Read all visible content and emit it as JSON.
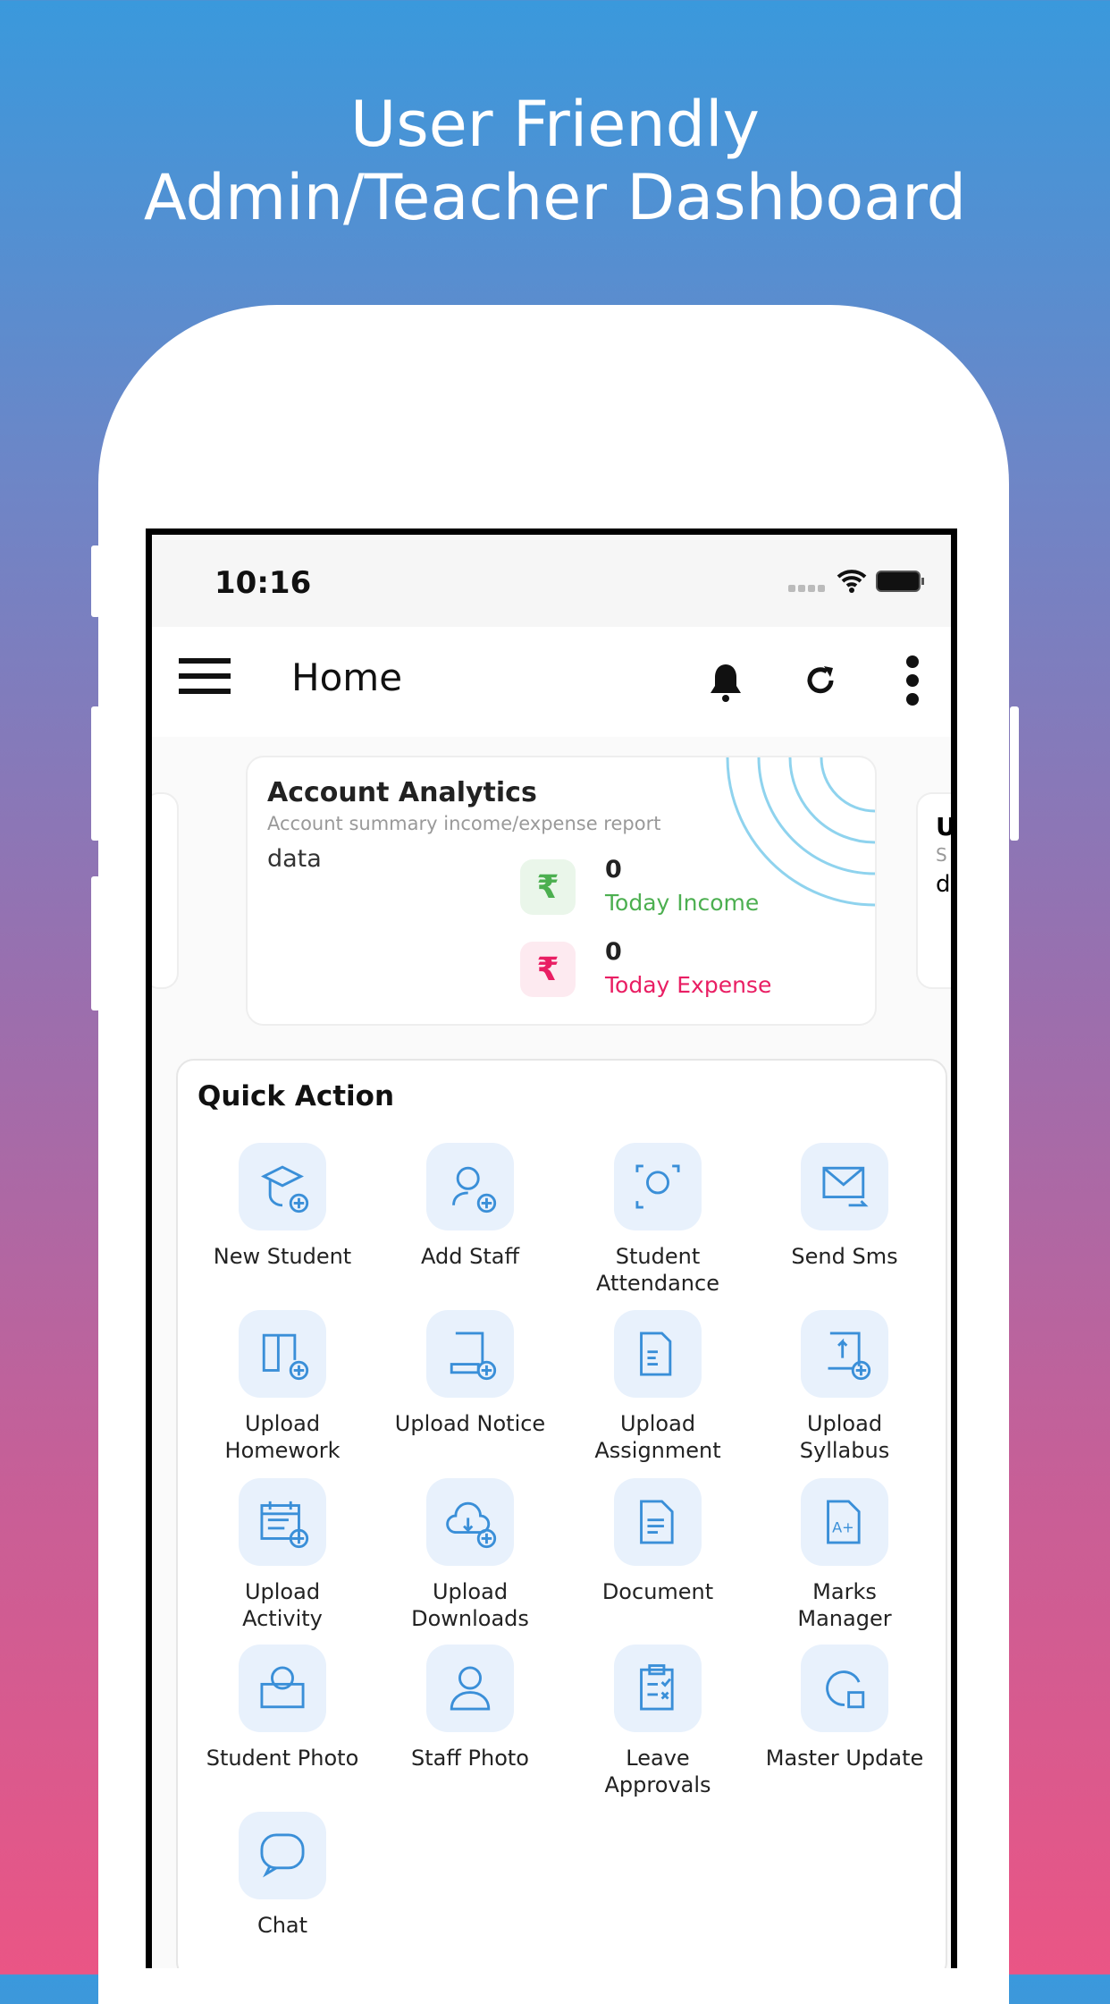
{
  "headline": {
    "line1": "User Friendly",
    "line2": "Admin/Teacher Dashboard"
  },
  "status_bar": {
    "time": "10:16"
  },
  "app_bar": {
    "title": "Home",
    "icons": [
      "menu-icon",
      "bell-icon",
      "refresh-icon",
      "more-vertical-icon"
    ]
  },
  "account_card": {
    "title": "Account Analytics",
    "subtitle": "Account summary income/expense report",
    "data_label": "data",
    "income": {
      "value": "0",
      "label": "Today Income",
      "color": "#4caf50",
      "currency": "₹"
    },
    "expense": {
      "value": "0",
      "label": "Today Expense",
      "color": "#e91e63",
      "currency": "₹"
    }
  },
  "next_card_peek": {
    "title": "U",
    "subtitle": "S",
    "data": "d"
  },
  "quick_action": {
    "title": "Quick Action",
    "accent": "#3a8fd8",
    "items": [
      {
        "label": "New Student",
        "icon": "student-add-icon"
      },
      {
        "label": "Add Staff",
        "icon": "staff-add-icon"
      },
      {
        "label": "Student\nAttendance",
        "icon": "attendance-icon"
      },
      {
        "label": "Send Sms",
        "icon": "mail-send-icon"
      },
      {
        "label": "Upload\nHomework",
        "icon": "book-add-icon"
      },
      {
        "label": "Upload Notice",
        "icon": "notice-add-icon"
      },
      {
        "label": "Upload\nAssignment",
        "icon": "assignment-icon"
      },
      {
        "label": "Upload\nSyllabus",
        "icon": "syllabus-upload-icon"
      },
      {
        "label": "Upload\nActivity",
        "icon": "calendar-add-icon"
      },
      {
        "label": "Upload\nDownloads",
        "icon": "cloud-download-icon"
      },
      {
        "label": "Document",
        "icon": "document-icon"
      },
      {
        "label": "Marks\nManager",
        "icon": "marks-icon"
      },
      {
        "label": "Student Photo",
        "icon": "student-photo-icon"
      },
      {
        "label": "Staff Photo",
        "icon": "staff-photo-icon"
      },
      {
        "label": "Leave\nApprovals",
        "icon": "checklist-icon"
      },
      {
        "label": "Master Update",
        "icon": "update-icon"
      },
      {
        "label": "Chat",
        "icon": "chat-icon"
      }
    ]
  }
}
